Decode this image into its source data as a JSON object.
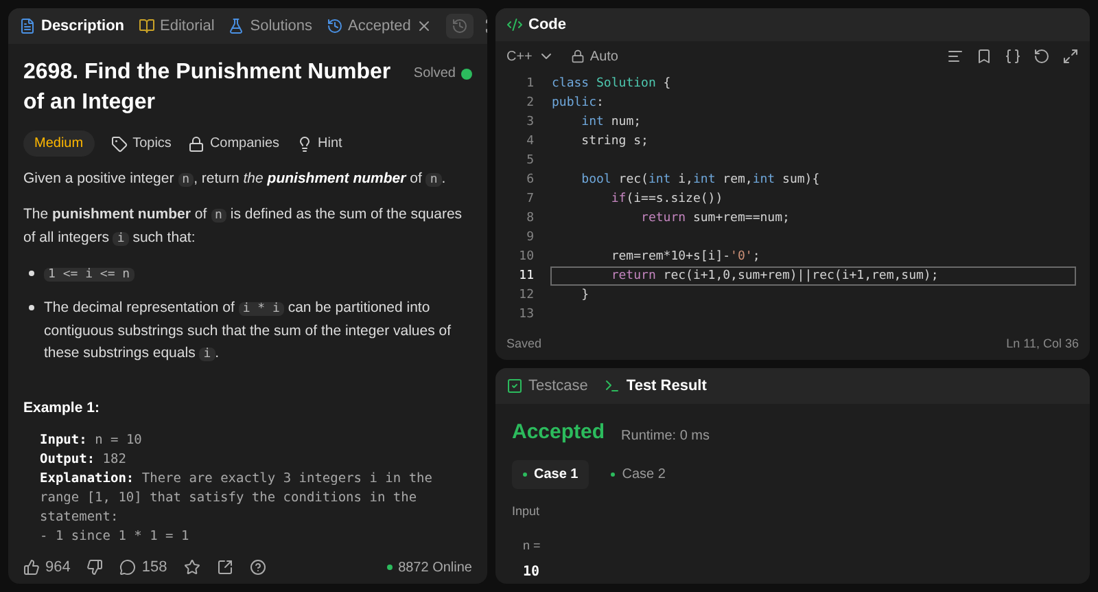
{
  "left_tabs": [
    {
      "label": "Description",
      "selected": true
    },
    {
      "label": "Editorial",
      "selected": false
    },
    {
      "label": "Solutions",
      "selected": false
    },
    {
      "label": "Accepted",
      "selected": false,
      "closable": true
    }
  ],
  "problem": {
    "title": "2698. Find the Punishment Number of an Integer",
    "status": "Solved",
    "difficulty": "Medium",
    "tags": [
      {
        "label": "Topics"
      },
      {
        "label": "Companies"
      },
      {
        "label": "Hint"
      }
    ],
    "paragraphs": [
      [
        {
          "kind": "text",
          "text": "Given a positive integer "
        },
        {
          "kind": "code",
          "text": "n"
        },
        {
          "kind": "text",
          "text": ", return *the* "
        },
        {
          "kind": "emphasis",
          "text": "punishment number"
        },
        {
          "kind": "text",
          "text": " of "
        },
        {
          "kind": "code",
          "text": "n"
        },
        {
          "kind": "text",
          "text": "."
        }
      ],
      [
        {
          "kind": "text",
          "text": "The **punishment number** of "
        },
        {
          "kind": "code",
          "text": "n"
        },
        {
          "kind": "text",
          "text": " is defined as the sum of the squares of all integers "
        },
        {
          "kind": "code",
          "text": "i"
        },
        {
          "kind": "text",
          "text": " such that:"
        }
      ]
    ],
    "bullets": [
      [
        {
          "kind": "code",
          "text": "1 <= i <= n"
        }
      ],
      [
        {
          "kind": "text",
          "text": "The decimal representation of "
        },
        {
          "kind": "code",
          "text": "i * i"
        },
        {
          "kind": "text",
          "text": " can be partitioned into contiguous substrings such that the sum of the integer values of these substrings equals "
        },
        {
          "kind": "code",
          "text": "i"
        },
        {
          "kind": "text",
          "text": "."
        }
      ]
    ],
    "example": {
      "title": "Example 1:",
      "lines": [
        {
          "label": "Input:",
          "text": "n = 10"
        },
        {
          "label": "Output:",
          "text": "182"
        },
        {
          "label": "Explanation:",
          "text": "There are exactly 3 integers i in the range [1, 10] that satisfy the conditions in the statement:"
        },
        {
          "text": "- 1 since 1 * 1 = 1"
        }
      ]
    }
  },
  "footer": {
    "likes": "964",
    "comments": "158",
    "online": "8872 Online"
  },
  "code_panel": {
    "title": "Code",
    "language": "C++",
    "mode": "Auto",
    "lines": [
      {
        "number": "1",
        "current": false,
        "tokens": [
          {
            "kind": "keyword",
            "text": "class "
          },
          {
            "kind": "type",
            "text": "Solution"
          },
          {
            "kind": "plain",
            "text": " {"
          }
        ]
      },
      {
        "number": "2",
        "current": false,
        "tokens": [
          {
            "kind": "keyword",
            "text": "public"
          },
          {
            "kind": "plain",
            "text": ":"
          }
        ]
      },
      {
        "number": "3",
        "current": false,
        "tokens": [
          {
            "kind": "keyword",
            "text": "    int"
          },
          {
            "kind": "plain",
            "text": " num;"
          }
        ]
      },
      {
        "number": "4",
        "current": false,
        "tokens": [
          {
            "kind": "plain",
            "text": "    string s;"
          }
        ]
      },
      {
        "number": "5",
        "current": false
      },
      {
        "number": "6",
        "current": false,
        "tokens": [
          {
            "kind": "keyword",
            "text": "    bool"
          },
          {
            "kind": "plain",
            "text": " rec("
          },
          {
            "kind": "keyword",
            "text": "int"
          },
          {
            "kind": "plain",
            "text": " i,"
          },
          {
            "kind": "keyword",
            "text": "int"
          },
          {
            "kind": "plain",
            "text": " rem,"
          },
          {
            "kind": "keyword",
            "text": "int"
          },
          {
            "kind": "plain",
            "text": " sum){"
          }
        ]
      },
      {
        "number": "7",
        "current": false,
        "tokens": [
          {
            "kind": "control",
            "text": "        if"
          },
          {
            "kind": "plain",
            "text": "(i==s.size())"
          }
        ]
      },
      {
        "number": "8",
        "current": false,
        "tokens": [
          {
            "kind": "control",
            "text": "            return"
          },
          {
            "kind": "plain",
            "text": " sum+rem==num;"
          }
        ]
      },
      {
        "number": "9",
        "current": false
      },
      {
        "number": "10",
        "current": false,
        "tokens": [
          {
            "kind": "plain",
            "text": "        rem=rem*10+s[i]-"
          },
          {
            "kind": "string",
            "text": "'0'"
          },
          {
            "kind": "plain",
            "text": ";"
          }
        ]
      },
      {
        "number": "11",
        "current": true,
        "tokens": [
          {
            "kind": "control",
            "text": "        return"
          },
          {
            "kind": "plain",
            "text": " rec(i+1,0,sum+rem)||rec(i+1,rem,sum);"
          }
        ]
      },
      {
        "number": "12",
        "current": false,
        "tokens": [
          {
            "kind": "plain",
            "text": "    }"
          }
        ]
      },
      {
        "number": "13",
        "current": false
      }
    ],
    "save_status": "Saved",
    "cursor": "Ln 11, Col 36"
  },
  "result_panel": {
    "tabs": [
      {
        "label": "Testcase",
        "selected": false
      },
      {
        "label": "Test Result",
        "selected": true
      }
    ],
    "verdict": "Accepted",
    "runtime": "Runtime: 0 ms",
    "cases": [
      {
        "label": "Case 1",
        "selected": true
      },
      {
        "label": "Case 2",
        "selected": false
      }
    ],
    "input_label": "Input",
    "variable": "n =",
    "value": "10"
  }
}
